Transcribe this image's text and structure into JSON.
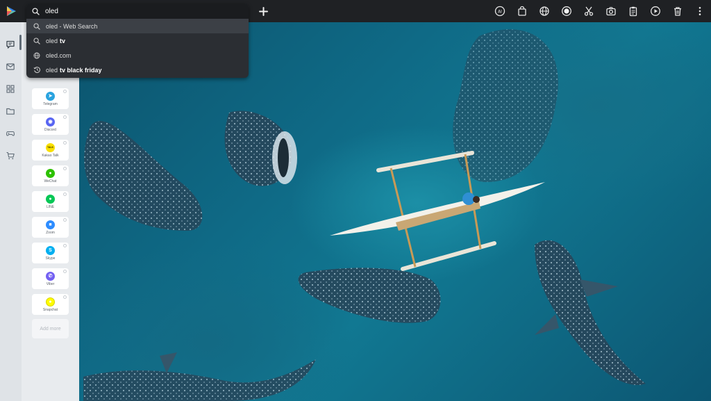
{
  "search": {
    "query": "oled",
    "suggestions": [
      {
        "icon": "search-icon",
        "text": "oled - Web Search",
        "bold": ""
      },
      {
        "icon": "search-icon",
        "text": "oled",
        "bold": "tv"
      },
      {
        "icon": "globe-icon",
        "text": "oled.com",
        "bold": ""
      },
      {
        "icon": "history-icon",
        "text": "oled",
        "bold": "tv black friday"
      }
    ]
  },
  "toolbar": {
    "icons": [
      "ai-icon",
      "shopping-bag-icon",
      "globe-icon",
      "record-icon",
      "scissors-icon",
      "camera-icon",
      "clipboard-icon",
      "play-icon",
      "trash-icon",
      "more-icon"
    ]
  },
  "rail": {
    "icons": [
      "messenger-icon",
      "mail-icon",
      "apps-icon",
      "folder-icon",
      "gamepad-icon",
      "cart-icon"
    ]
  },
  "messenger": {
    "apps": [
      {
        "name": "Telegram",
        "color": "#2aa3df",
        "glyph": "➤"
      },
      {
        "name": "Discord",
        "color": "#5865f2",
        "glyph": "◉"
      },
      {
        "name": "Kakao Talk",
        "color": "#f9e000",
        "glyph": "TALK"
      },
      {
        "name": "WeChat",
        "color": "#2dc100",
        "glyph": "●"
      },
      {
        "name": "LINE",
        "color": "#06c755",
        "glyph": "●"
      },
      {
        "name": "Zoom",
        "color": "#2d8cff",
        "glyph": "■"
      },
      {
        "name": "Skype",
        "color": "#00aff0",
        "glyph": "S"
      },
      {
        "name": "Viber",
        "color": "#7360f2",
        "glyph": "✆"
      },
      {
        "name": "Snapchat",
        "color": "#fffc00",
        "glyph": "●"
      }
    ],
    "add_more": "Add more"
  },
  "colors": {
    "topbar": "#1f2124",
    "dropdown": "#2b2e33",
    "rail": "#dfe3e7",
    "panel": "#e8ebee",
    "ocean": "#0f6a86"
  }
}
